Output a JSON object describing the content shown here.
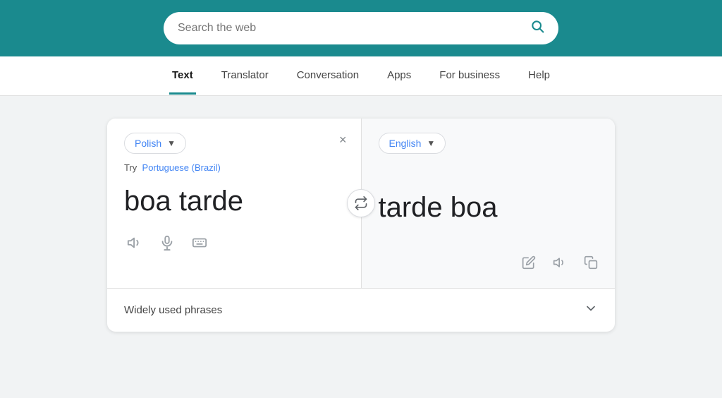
{
  "header": {
    "search_placeholder": "Search the web",
    "brand_color": "#1a8a8e"
  },
  "nav": {
    "items": [
      {
        "label": "Text",
        "active": true
      },
      {
        "label": "Translator",
        "active": false
      },
      {
        "label": "Conversation",
        "active": false
      },
      {
        "label": "Apps",
        "active": false
      },
      {
        "label": "For business",
        "active": false
      },
      {
        "label": "Help",
        "active": false
      }
    ]
  },
  "translator": {
    "source_lang": "Polish",
    "target_lang": "English",
    "suggest_prefix": "Try",
    "suggest_lang": "Portuguese (Brazil)",
    "source_text": "boa tarde",
    "target_text": "tarde boa",
    "clear_button": "×",
    "swap_button": "⇄",
    "toolbar_left": {
      "speaker_icon": "🔊",
      "mic_icon": "🎤",
      "keyboard_icon": "⌨"
    },
    "toolbar_right": {
      "edit_icon": "✏",
      "speaker_icon": "🔊",
      "copy_icon": "⧉"
    },
    "phrases_label": "Widely used phrases",
    "phrases_chevron": "∨",
    "lang_arrow": "▼"
  }
}
